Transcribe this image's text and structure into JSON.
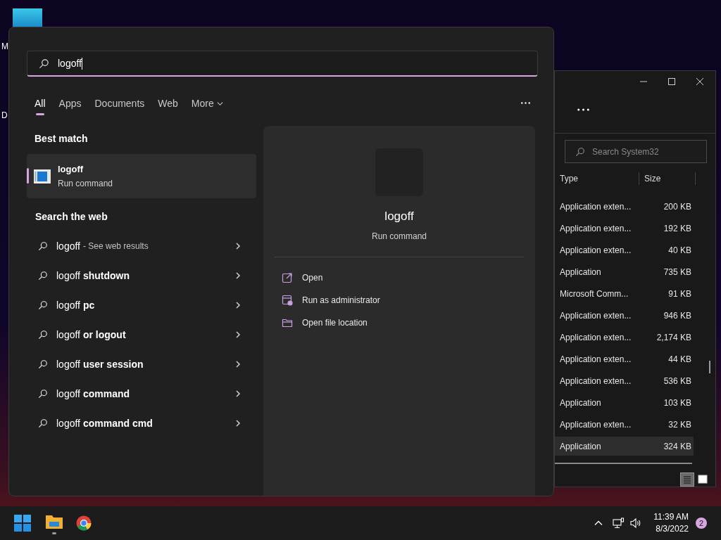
{
  "desktop_icons": [
    {
      "label": "M"
    },
    {
      "label": "D"
    }
  ],
  "search": {
    "query": "logoff",
    "tabs": [
      {
        "label": "All",
        "selected": true
      },
      {
        "label": "Apps",
        "selected": false
      },
      {
        "label": "Documents",
        "selected": false
      },
      {
        "label": "Web",
        "selected": false
      },
      {
        "label": "More",
        "selected": false,
        "dropdown": true
      }
    ],
    "best_match_heading": "Best match",
    "best_match": {
      "title": "logoff",
      "subtitle": "Run command",
      "selected": true
    },
    "web_heading": "Search the web",
    "web_results": [
      {
        "text": "logoff",
        "hint": "- See web results"
      },
      {
        "text": "logoff **shutdown**"
      },
      {
        "text": "logoff **pc**"
      },
      {
        "text": "logoff **or logout**"
      },
      {
        "text": "logoff **user session**"
      },
      {
        "text": "logoff **command**"
      },
      {
        "text": "logoff **command cmd**"
      }
    ],
    "preview": {
      "title": "logoff",
      "subtitle": "Run command",
      "actions": [
        {
          "kind": "open",
          "label": "Open"
        },
        {
          "kind": "admin",
          "label": "Run as administrator"
        },
        {
          "kind": "folder",
          "label": "Open file location"
        }
      ]
    }
  },
  "explorer": {
    "search_placeholder": "Search System32",
    "columns": [
      "Type",
      "Size"
    ],
    "rows": [
      {
        "type": "Application exten...",
        "size": "200 KB",
        "selected": false
      },
      {
        "type": "Application exten...",
        "size": "192 KB",
        "selected": false
      },
      {
        "type": "Application exten...",
        "size": "40 KB",
        "selected": false
      },
      {
        "type": "Application",
        "size": "735 KB",
        "selected": false
      },
      {
        "type": "Microsoft Comm...",
        "size": "91 KB",
        "selected": false
      },
      {
        "type": "Application exten...",
        "size": "946 KB",
        "selected": false
      },
      {
        "type": "Application exten...",
        "size": "2,174 KB",
        "selected": false
      },
      {
        "type": "Application exten...",
        "size": "44 KB",
        "selected": false
      },
      {
        "type": "Application exten...",
        "size": "536 KB",
        "selected": false
      },
      {
        "type": "Application",
        "size": "103 KB",
        "selected": false
      },
      {
        "type": "Application exten...",
        "size": "32 KB",
        "selected": false
      },
      {
        "type": "Application",
        "size": "324 KB",
        "selected": true
      }
    ],
    "view_buttons": [
      {
        "kind": "details",
        "selected": true
      },
      {
        "kind": "tiles",
        "selected": false
      }
    ]
  },
  "taskbar": {
    "time": "11:39 AM",
    "date": "8/3/2022",
    "notifications": "2"
  }
}
